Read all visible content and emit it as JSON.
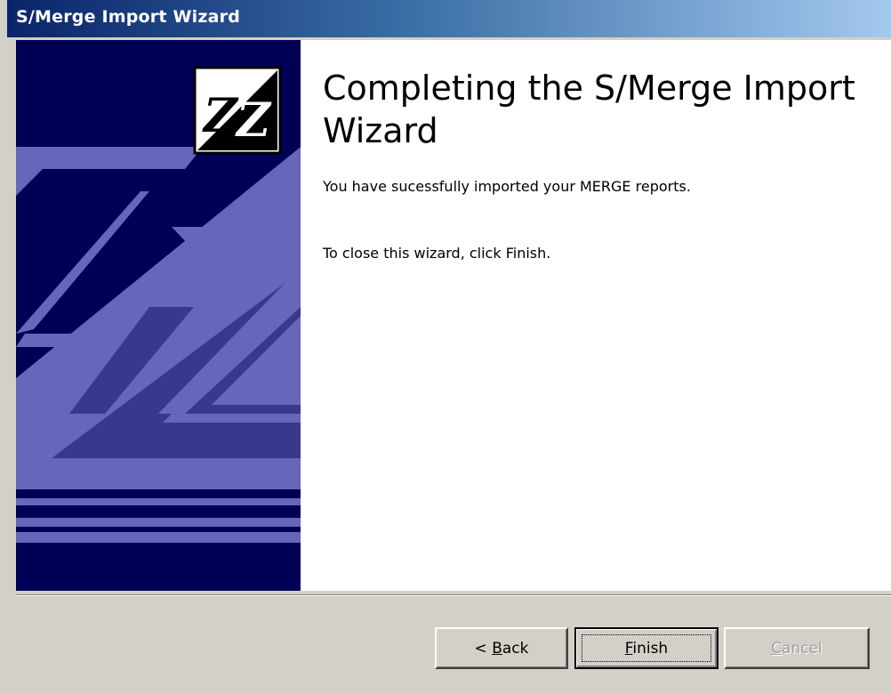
{
  "window": {
    "title": "S/Merge Import Wizard"
  },
  "content": {
    "heading": "Completing the S/Merge Import Wizard",
    "message_success": "You have sucessfully imported your MERGE reports.",
    "message_close": "To close this wizard, click Finish."
  },
  "buttons": {
    "back": {
      "prefix": "< ",
      "mnemonic": "B",
      "rest": "ack"
    },
    "finish": {
      "prefix": "",
      "mnemonic": "F",
      "rest": "inish"
    },
    "cancel": {
      "prefix": "",
      "mnemonic": "C",
      "rest": "ancel",
      "enabled": false
    }
  },
  "banner": {
    "logo": "zz-logo",
    "colors": {
      "dark": "#000055",
      "light": "#6666bb"
    }
  }
}
